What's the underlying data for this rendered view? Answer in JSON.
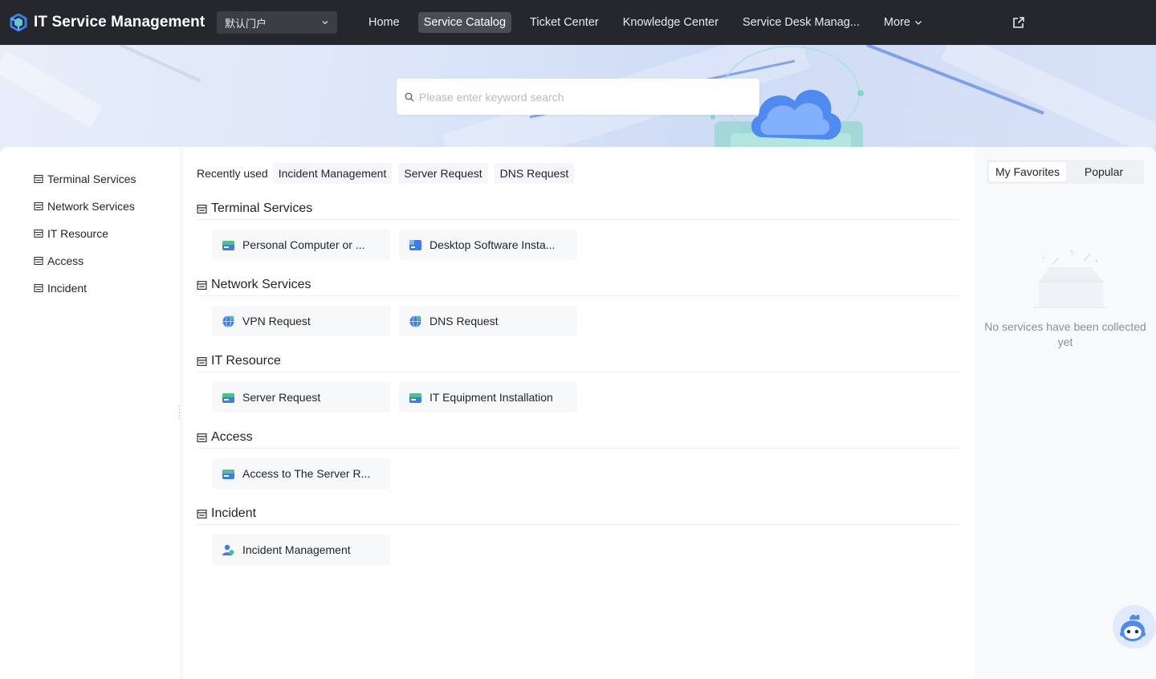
{
  "header": {
    "app_title": "IT Service Management",
    "portal_select": "默认门户",
    "nav": [
      {
        "label": "Home"
      },
      {
        "label": "Service Catalog",
        "active": true
      },
      {
        "label": "Ticket Center"
      },
      {
        "label": "Knowledge Center"
      },
      {
        "label": "Service Desk Manag..."
      },
      {
        "label": "More"
      }
    ]
  },
  "search": {
    "placeholder": "Please enter keyword search"
  },
  "sidebar": {
    "items": [
      {
        "label": "Terminal Services"
      },
      {
        "label": "Network Services"
      },
      {
        "label": "IT Resource"
      },
      {
        "label": "Access"
      },
      {
        "label": "Incident"
      }
    ]
  },
  "recent": {
    "label": "Recently used",
    "chips": [
      "Incident Management",
      "Server Request",
      "DNS Request"
    ]
  },
  "sections": [
    {
      "title": "Terminal Services",
      "items": [
        {
          "label": "Personal Computer or ...",
          "icon": "folder-icon"
        },
        {
          "label": "Desktop Software Insta...",
          "icon": "app-window-icon"
        }
      ]
    },
    {
      "title": "Network Services",
      "items": [
        {
          "label": "VPN Request",
          "icon": "network-globe-icon"
        },
        {
          "label": "DNS Request",
          "icon": "network-globe-icon"
        }
      ]
    },
    {
      "title": "IT Resource",
      "items": [
        {
          "label": "Server Request",
          "icon": "folder-icon"
        },
        {
          "label": "IT Equipment Installation",
          "icon": "folder-icon"
        }
      ]
    },
    {
      "title": "Access",
      "items": [
        {
          "label": "Access to The Server R...",
          "icon": "folder-icon"
        }
      ]
    },
    {
      "title": "Incident",
      "items": [
        {
          "label": "Incident Management",
          "icon": "user-group-icon"
        }
      ]
    }
  ],
  "right_panel": {
    "tabs": [
      {
        "label": "My Favorites",
        "active": true
      },
      {
        "label": "Popular"
      }
    ],
    "empty_text": "No services have been collected yet"
  },
  "colors": {
    "topbar": "#25272c",
    "accent_blue": "#3b7cf0",
    "accent_green": "#4fc18a"
  }
}
